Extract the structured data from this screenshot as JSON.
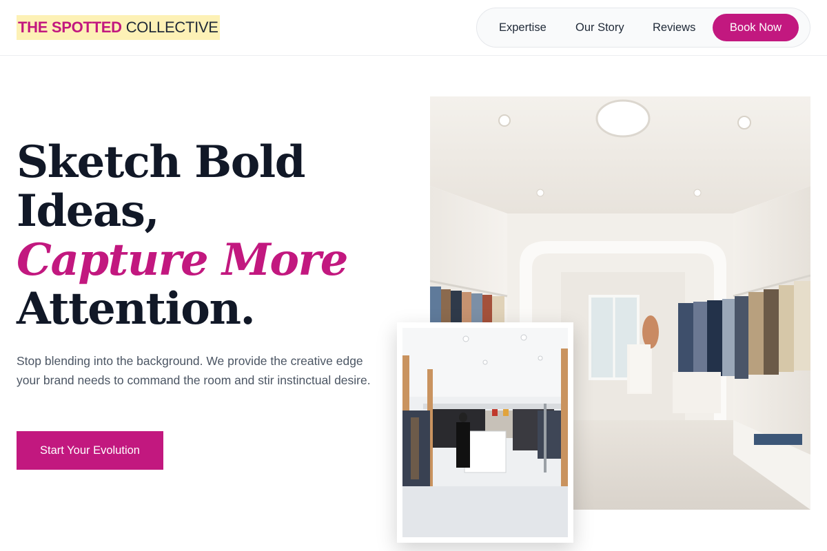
{
  "brand": {
    "name_primary": "THE SPOTTED",
    "name_secondary": "COLLECTIVE",
    "accent_color": "#c2187f",
    "highlight_color": "#fdf1b6"
  },
  "nav": {
    "links": [
      "Expertise",
      "Our Story",
      "Reviews"
    ],
    "cta_label": "Book Now"
  },
  "hero": {
    "headline_lines": [
      "Sketch Bold",
      "Ideas,",
      "Capture More",
      "Attention."
    ],
    "subtext": "Stop blending into the background. We provide the creative edge your brand needs to command the room and stir instinctual desire.",
    "cta_label": "Start Your Evolution"
  },
  "images": {
    "main": "boutique-interior-photo",
    "secondary": "store-floor-photo"
  }
}
